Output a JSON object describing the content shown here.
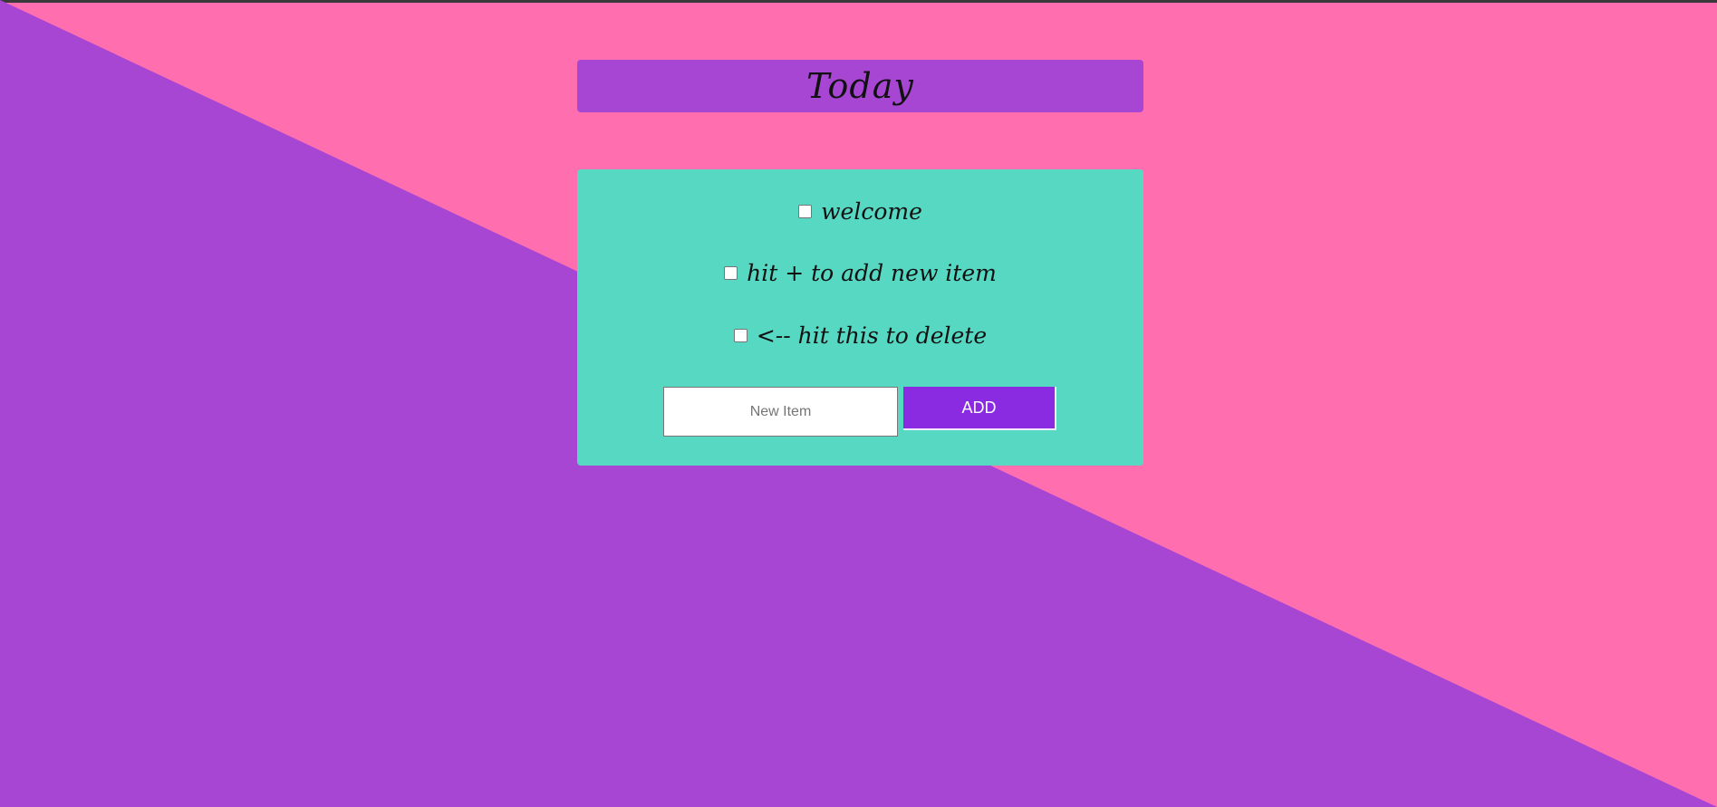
{
  "colors": {
    "background_pink": "#ff6fb0",
    "background_purple": "#a846d4",
    "card_teal": "#56d8c3",
    "button_purple": "#8a2be2"
  },
  "header": {
    "title": "Today"
  },
  "list": {
    "items": [
      {
        "label": "welcome",
        "checked": false
      },
      {
        "label": "hit + to add new item",
        "checked": false
      },
      {
        "label": "<-- hit this to delete",
        "checked": false
      }
    ]
  },
  "form": {
    "input_value": "",
    "input_placeholder": "New Item",
    "add_label": "ADD"
  }
}
